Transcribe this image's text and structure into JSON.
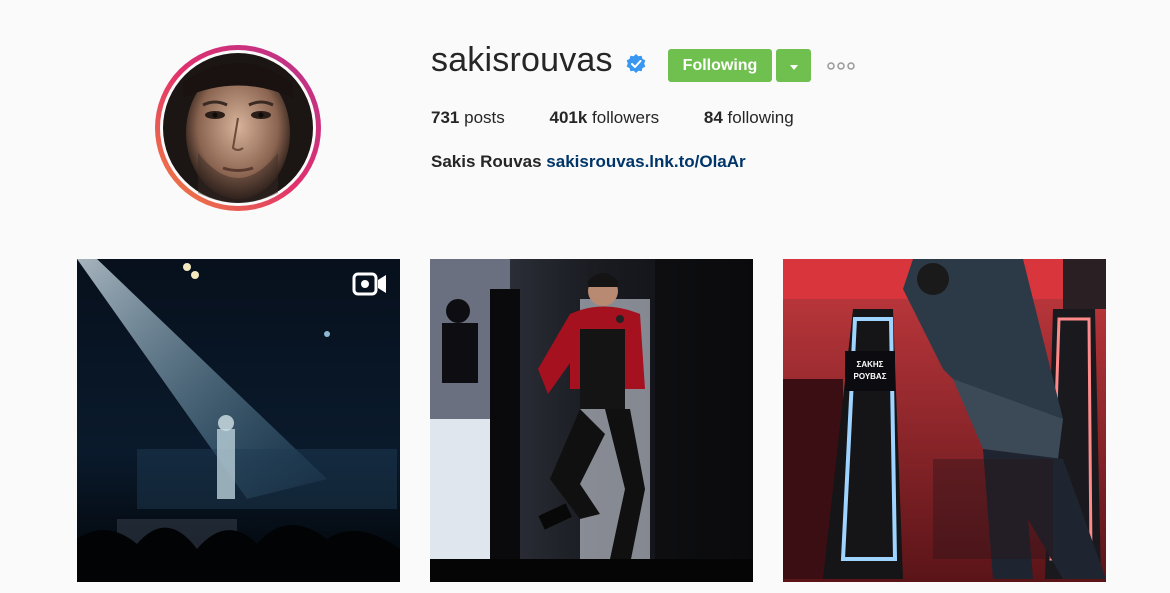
{
  "profile": {
    "username": "sakisrouvas",
    "verified": true,
    "follow_label": "Following",
    "full_name": "Sakis Rouvas",
    "link": "sakisrouvas.lnk.to/OlaAr"
  },
  "stats": [
    {
      "count": "731",
      "label": "posts"
    },
    {
      "count": "401k",
      "label": "followers"
    },
    {
      "count": "84",
      "label": "following"
    }
  ],
  "posts": [
    {
      "type": "video",
      "icon": "video-camera-icon"
    },
    {
      "type": "photo"
    },
    {
      "type": "photo",
      "nameplate": "ΣΑΚΗΣ ΡΟΥΒΑΣ"
    }
  ],
  "colors": {
    "follow_button": "#70c050",
    "link": "#003569",
    "verified_badge": "#3897f0",
    "background": "#fafafa"
  }
}
